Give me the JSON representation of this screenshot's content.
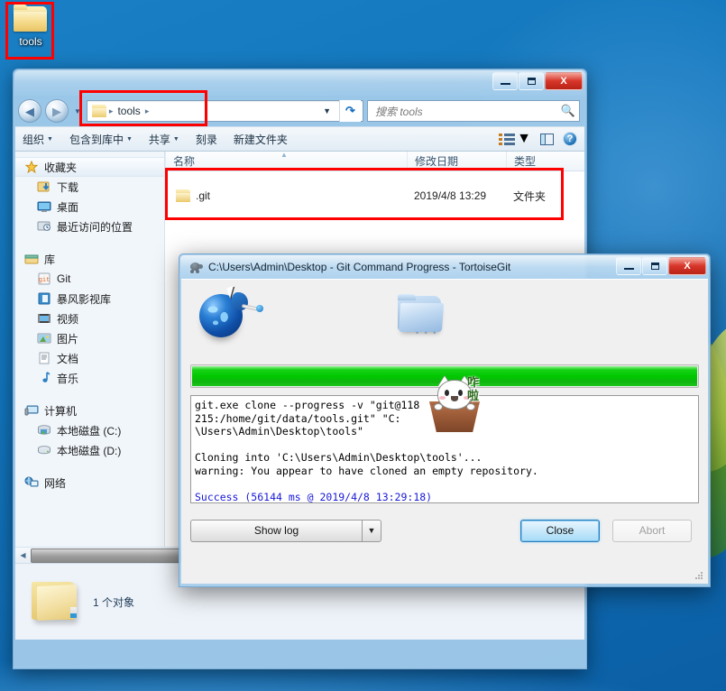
{
  "desktop": {
    "icon": {
      "label": "tools",
      "icon": "folder-icon"
    }
  },
  "explorer": {
    "window_buttons": {
      "minimize": "–",
      "maximize": "□",
      "close": "X"
    },
    "nav": {
      "back": "◀",
      "forward": "▶",
      "recent_chevron": "▼"
    },
    "address": {
      "icon": "folder-icon",
      "crumbs": [
        "tools"
      ],
      "separator": "▸",
      "dropdown_chevron": "▼",
      "refresh_icon": "refresh-icon"
    },
    "search": {
      "placeholder": "搜索 tools",
      "icon": "search-icon"
    },
    "toolbar": {
      "items": [
        {
          "label": "组织",
          "caret": "▼"
        },
        {
          "label": "包含到库中",
          "caret": "▼"
        },
        {
          "label": "共享",
          "caret": "▼"
        },
        {
          "label": "刻录",
          "caret": ""
        },
        {
          "label": "新建文件夹",
          "caret": ""
        }
      ],
      "view_caret": "▼"
    },
    "navpane": {
      "groups": [
        {
          "header": {
            "label": "收藏夹",
            "icon": "star-icon",
            "selected": true
          },
          "items": [
            {
              "label": "下载",
              "icon": "downloads-icon"
            },
            {
              "label": "桌面",
              "icon": "desktop-icon"
            },
            {
              "label": "最近访问的位置",
              "icon": "recent-places-icon"
            }
          ]
        },
        {
          "header": {
            "label": "库",
            "icon": "library-icon",
            "selected": false
          },
          "items": [
            {
              "label": "Git",
              "icon": "git-library-icon"
            },
            {
              "label": "暴风影视库",
              "icon": "video-library-icon"
            },
            {
              "label": "视频",
              "icon": "videos-icon"
            },
            {
              "label": "图片",
              "icon": "pictures-icon"
            },
            {
              "label": "文档",
              "icon": "documents-icon"
            },
            {
              "label": "音乐",
              "icon": "music-icon"
            }
          ]
        },
        {
          "header": {
            "label": "计算机",
            "icon": "computer-icon",
            "selected": false
          },
          "items": [
            {
              "label": "本地磁盘 (C:)",
              "icon": "system-drive-icon"
            },
            {
              "label": "本地磁盘 (D:)",
              "icon": "drive-icon"
            }
          ]
        },
        {
          "header": {
            "label": "网络",
            "icon": "network-icon",
            "selected": false
          },
          "items": []
        }
      ]
    },
    "list": {
      "columns": [
        "名称",
        "修改日期",
        "类型"
      ],
      "sort_indicator": "▲",
      "rows": [
        {
          "name": ".git",
          "modified": "2019/4/8 13:29",
          "type": "文件夹",
          "icon": "folder-icon"
        }
      ]
    },
    "hscroll": {
      "left_arrow": "◀",
      "right_arrow": "▶",
      "grip": "⫿i"
    },
    "status": {
      "text": "1 个对象",
      "icon": "folder-icon"
    }
  },
  "tortoisegit": {
    "title": "C:\\Users\\Admin\\Desktop - Git Command Progress - TortoiseGit",
    "title_icon": "tortoise-icon",
    "window_buttons": {
      "minimize": "–",
      "maximize": "□",
      "close": "X"
    },
    "graphics": {
      "source_icon": "globe-network-icon",
      "target_icon": "folder-icon",
      "ellipsis": "• • •"
    },
    "progress": {
      "percent": 100,
      "color": "#00c800"
    },
    "log": {
      "line1": "git.exe clone --progress -v \"git@118                215:/home/git/data/tools.git\" \"C:",
      "line2": "\\Users\\Admin\\Desktop\\tools\"",
      "line3": "",
      "line4": "Cloning into 'C:\\Users\\Admin\\Desktop\\tools'...",
      "line5": "warning: You appear to have cloned an empty repository.",
      "line6": "",
      "success": "Success (56144 ms @ 2019/4/8 13:29:18)"
    },
    "buttons": {
      "show_log": "Show log",
      "show_log_accesskey": "l",
      "show_log_caret": "▼",
      "close": "Close",
      "abort": "Abort"
    }
  },
  "mascot": {
    "text_line1": "咋",
    "text_line2": "啦",
    "icon": "cat-mascot-icon"
  },
  "highlights": {
    "color": "#ff0000"
  }
}
